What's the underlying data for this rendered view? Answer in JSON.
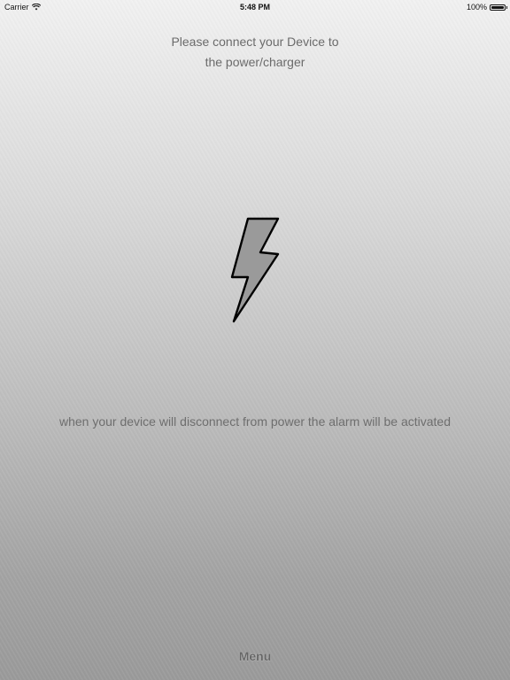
{
  "status_bar": {
    "carrier": "Carrier",
    "time": "5:48 PM",
    "battery": "100%",
    "battery_level": 1.0
  },
  "icons": {
    "wifi": "wifi-icon",
    "battery": "battery-icon",
    "lightning": "lightning-bolt-icon"
  },
  "main": {
    "heading_line1": "Please connect your Device to",
    "heading_line2": "the power/charger",
    "info": "when your device will disconnect from power the alarm will be activated"
  },
  "menu": {
    "label": "Menu"
  },
  "colors": {
    "bolt_fill": "#9a9a9a",
    "bolt_stroke": "#000000",
    "text": "#6b6b6b"
  }
}
